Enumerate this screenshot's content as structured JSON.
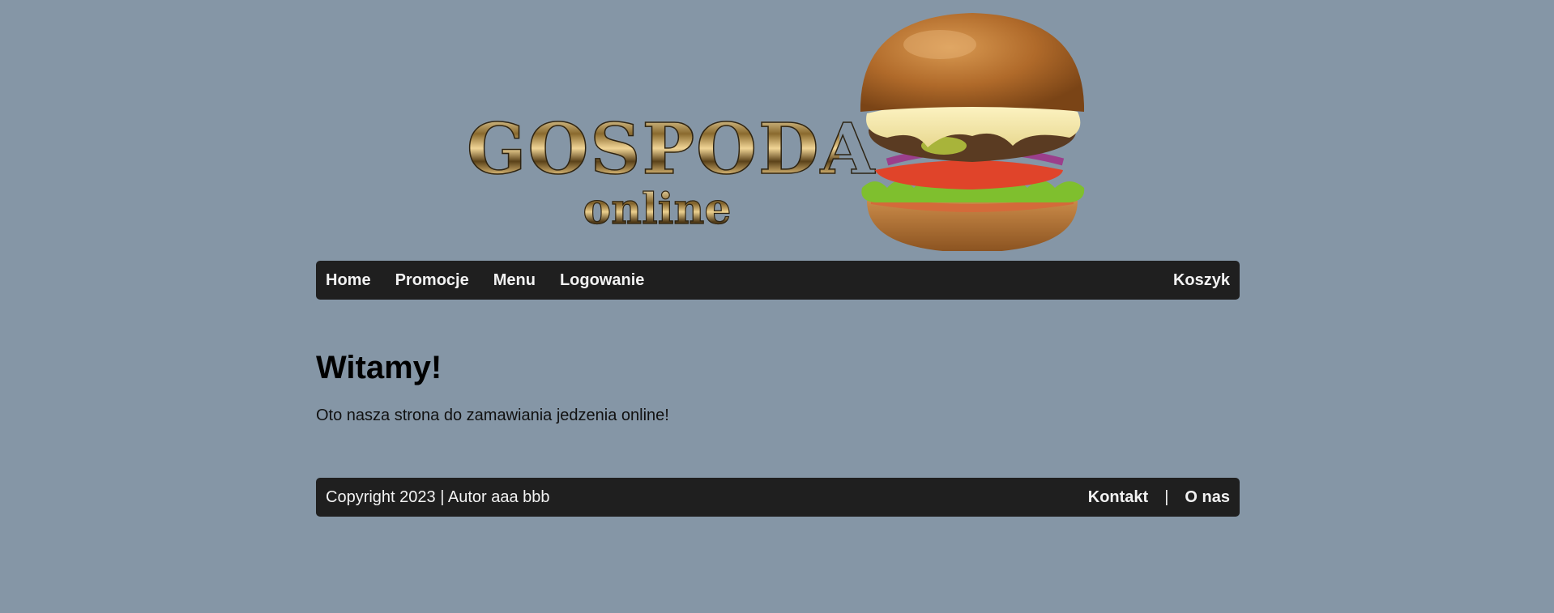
{
  "header": {
    "logo_main": "GOSPODA",
    "logo_sub": "online",
    "image_alt": "burger"
  },
  "nav": {
    "items": [
      {
        "label": "Home"
      },
      {
        "label": "Promocje"
      },
      {
        "label": "Menu"
      },
      {
        "label": "Logowanie"
      }
    ],
    "cart_label": "Koszyk"
  },
  "main": {
    "heading": "Witamy!",
    "text": "Oto nasza strona do zamawiania jedzenia online!"
  },
  "footer": {
    "copyright": "Copyright 2023 | Autor aaa bbb",
    "contact_label": "Kontakt",
    "separator": "|",
    "about_label": "O nas"
  },
  "colors": {
    "background": "#8596a6",
    "bar": "#1f1f1f",
    "bar_text": "#f2f2f2"
  }
}
